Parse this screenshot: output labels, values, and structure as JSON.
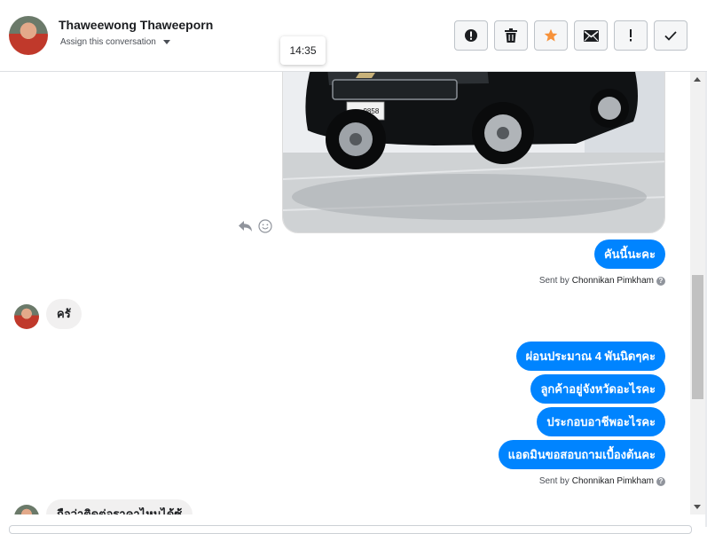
{
  "header": {
    "contact_name": "Thaweewong Thaweeporn",
    "assign_label": "Assign this conversation",
    "actions": [
      {
        "name": "mark-spam-button",
        "icon": "alert-circle-icon"
      },
      {
        "name": "delete-button",
        "icon": "trash-icon"
      },
      {
        "name": "star-button",
        "icon": "star-icon"
      },
      {
        "name": "mark-unread-button",
        "icon": "envelope-icon"
      },
      {
        "name": "follow-up-button",
        "icon": "exclamation-icon"
      },
      {
        "name": "mark-done-button",
        "icon": "checkmark-icon"
      }
    ]
  },
  "tooltip": {
    "time": "14:35"
  },
  "photo": {
    "plate_text": "บน 9858"
  },
  "messages": [
    {
      "direction": "out",
      "text": "คันนี้นะคะ"
    },
    {
      "direction": "meta",
      "prefix": "Sent by",
      "author": "Chonnikan Pimkham"
    },
    {
      "direction": "in",
      "text": "ครั"
    },
    {
      "direction": "out",
      "text": "ผ่อนประมาณ 4 พันนิดๆคะ"
    },
    {
      "direction": "out",
      "text": "ลูกค้าอยู่จังหวัดอะไรคะ"
    },
    {
      "direction": "out",
      "text": "ประกอบอาชีพอะไรคะ"
    },
    {
      "direction": "out",
      "text": "แอดมินขอสอบถามเบื้องต้นคะ"
    },
    {
      "direction": "meta",
      "prefix": "Sent by",
      "author": "Chonnikan Pimkham"
    },
    {
      "direction": "in",
      "text": "ถือว่าติดต่อราคาไหมได้ซ้"
    }
  ],
  "colors": {
    "outgoing": "#0084ff",
    "incoming": "#f1f0f0",
    "star": "#f7923a"
  }
}
